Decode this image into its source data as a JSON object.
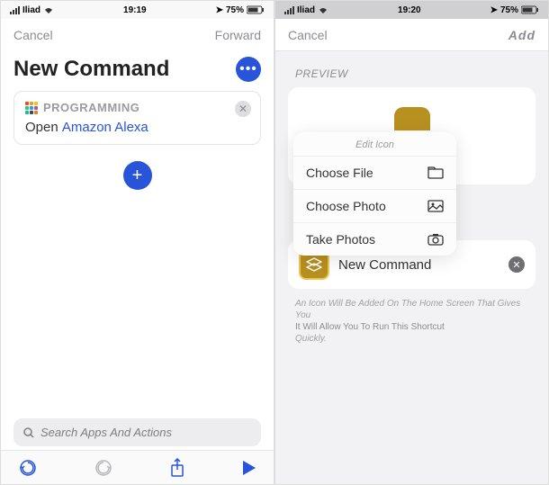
{
  "left": {
    "status": {
      "carrier": "Iliad",
      "time": "19:19",
      "battery": "75%"
    },
    "nav": {
      "cancel": "Cancel",
      "forward": "Forward"
    },
    "title": "New Command",
    "card": {
      "badge": "PROGRAMMING",
      "action_prefix": "Open ",
      "action_app": "Amazon Alexa"
    },
    "search_placeholder": "Search Apps And Actions"
  },
  "right": {
    "status": {
      "carrier": "Iliad",
      "time": "19:20",
      "battery": "75%"
    },
    "nav": {
      "cancel": "Cancel",
      "add": "Add"
    },
    "preview_label": "PREVIEW",
    "popup": {
      "title": "Edit Icon",
      "items": [
        "Choose File",
        "Choose Photo",
        "Take Photos"
      ]
    },
    "name": "New Command",
    "help": {
      "l1": "An Icon Will Be Added On The Home Screen That Gives You",
      "l2": "It Will Allow You To Run This Shortcut",
      "l3": "Quickly."
    }
  }
}
